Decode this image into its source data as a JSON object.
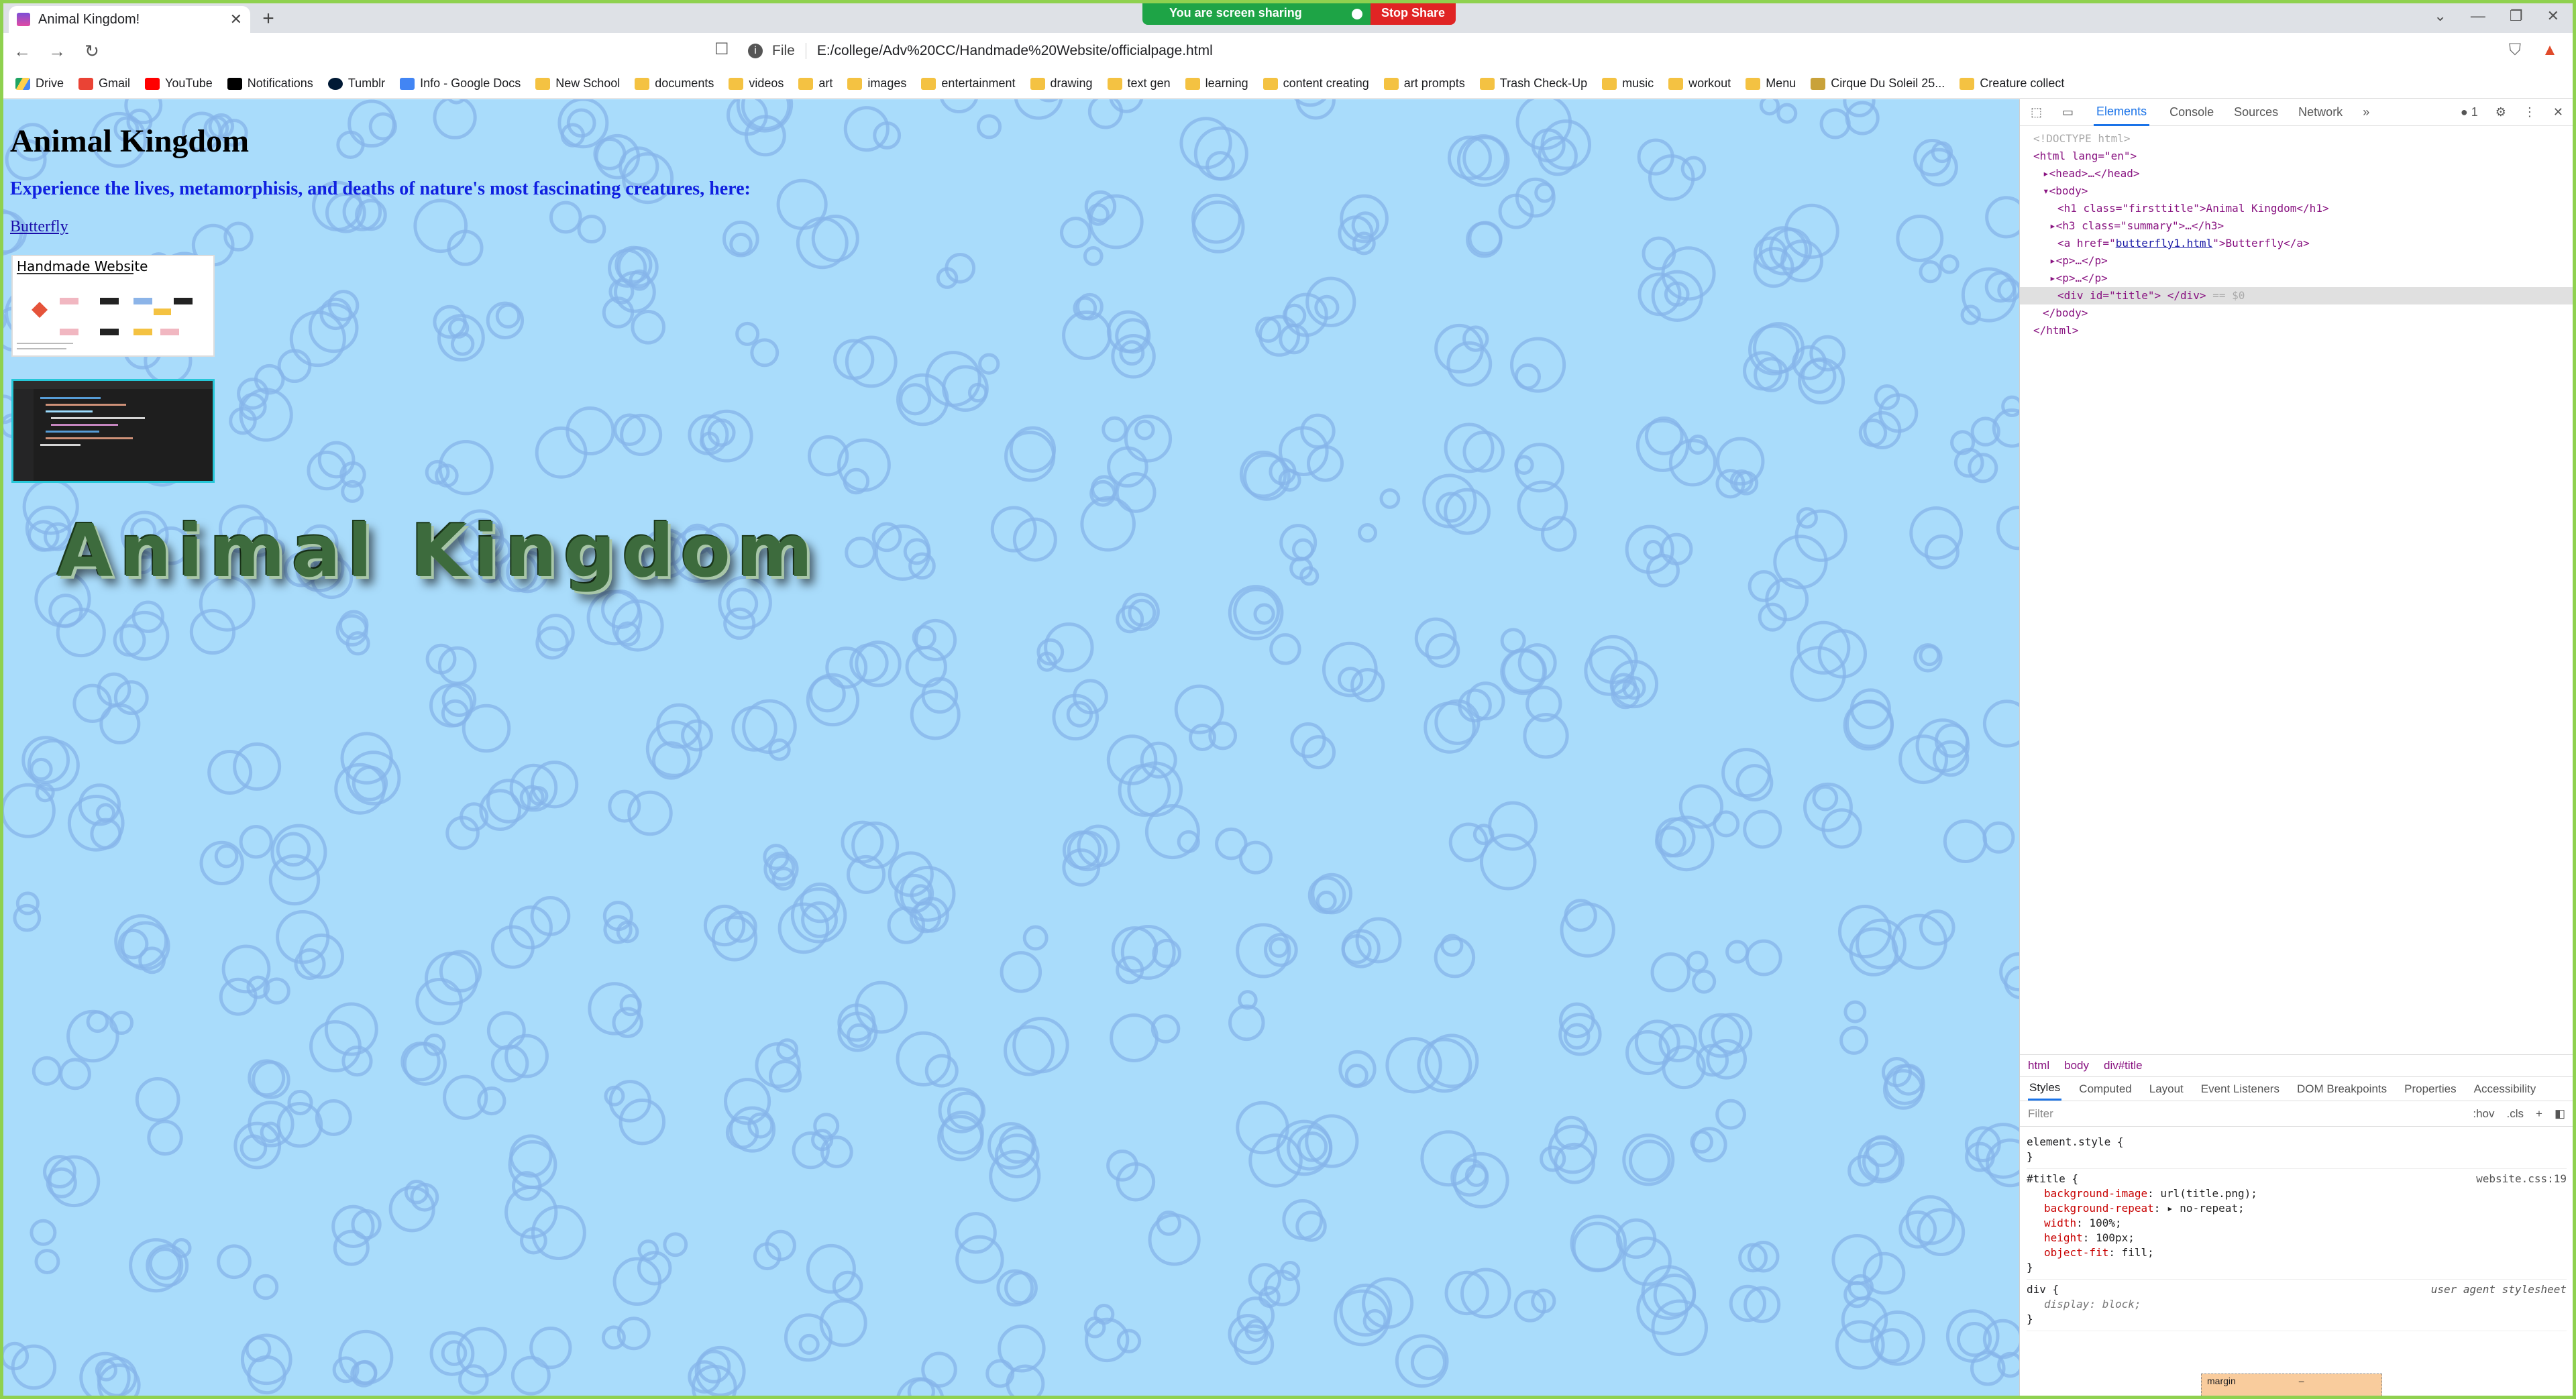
{
  "browser": {
    "tab_title": "Animal Kingdom!",
    "screen_share_label": "You are screen sharing",
    "stop_share_label": "Stop Share",
    "url_prefix": "File",
    "url": "E:/college/Adv%20CC/Handmade%20Website/officialpage.html"
  },
  "bookmarks": [
    {
      "label": "Drive",
      "icon": "drive-icon"
    },
    {
      "label": "Gmail",
      "icon": "gmail-icon"
    },
    {
      "label": "YouTube",
      "icon": "youtube-icon"
    },
    {
      "label": "Notifications",
      "icon": "x-icon"
    },
    {
      "label": "Tumblr",
      "icon": "tumblr-icon"
    },
    {
      "label": "Info - Google Docs",
      "icon": "docs-icon"
    },
    {
      "label": "New School",
      "icon": "folder-icon"
    },
    {
      "label": "documents",
      "icon": "folder-icon"
    },
    {
      "label": "videos",
      "icon": "folder-icon"
    },
    {
      "label": "art",
      "icon": "folder-icon"
    },
    {
      "label": "images",
      "icon": "folder-icon"
    },
    {
      "label": "entertainment",
      "icon": "folder-icon"
    },
    {
      "label": "drawing",
      "icon": "folder-icon"
    },
    {
      "label": "text gen",
      "icon": "folder-icon"
    },
    {
      "label": "learning",
      "icon": "folder-icon"
    },
    {
      "label": "content creating",
      "icon": "folder-icon"
    },
    {
      "label": "art prompts",
      "icon": "folder-icon"
    },
    {
      "label": "Trash Check-Up",
      "icon": "folder-icon"
    },
    {
      "label": "music",
      "icon": "folder-icon"
    },
    {
      "label": "workout",
      "icon": "folder-icon"
    },
    {
      "label": "Menu",
      "icon": "folder-icon"
    },
    {
      "label": "Cirque Du Soleil 25...",
      "icon": "cirque-icon"
    },
    {
      "label": "Creature collect",
      "icon": "folder-icon"
    }
  ],
  "page": {
    "heading": "Animal Kingdom",
    "summary": "Experience the lives, metamorphisis, and deaths of nature's most fascinating creatures, here:",
    "link_label": "Butterfly",
    "banner_text": "Animal Kingdom",
    "thumb1_title": "Handmade Website",
    "bg_color": "#a9dcfb"
  },
  "devtools": {
    "tabs": [
      "Elements",
      "Console",
      "Sources",
      "Network"
    ],
    "issues_count": "1",
    "dom_lines": {
      "doctype": "<!DOCTYPE html>",
      "html_open": "<html lang=\"en\">",
      "head": "<head>…</head>",
      "body_open": "<body>",
      "h1": "<h1 class=\"firsttitle\">Animal Kingdom</h1>",
      "h3": "<h3 class=\"summary\">…</h3>",
      "a_pre": "<a href=\"",
      "a_href": "butterfly1.html",
      "a_post": "\">Butterfly</a>",
      "p1": "<p>…</p>",
      "p2": "<p>…</p>",
      "div": "<div id=\"title\"> </div>",
      "div_marker": "== $0",
      "body_close": "</body>",
      "html_close": "</html>"
    },
    "breadcrumbs": [
      "html",
      "body",
      "div#title"
    ],
    "sub_tabs": [
      "Styles",
      "Computed",
      "Layout",
      "Event Listeners",
      "DOM Breakpoints",
      "Properties",
      "Accessibility"
    ],
    "filter_placeholder": "Filter",
    "filter_controls": [
      ":hov",
      ".cls",
      "+"
    ],
    "styles": {
      "element_style": "element.style {",
      "close": "}",
      "title_selector": "#title {",
      "title_source": "website.css:19",
      "props": [
        {
          "name": "background-image",
          "value": "url(title.png);"
        },
        {
          "name": "background-repeat",
          "value": "▸ no-repeat;"
        },
        {
          "name": "width",
          "value": "100%;"
        },
        {
          "name": "height",
          "value": "100px;"
        },
        {
          "name": "object-fit",
          "value": "fill;"
        }
      ],
      "div_selector": "div {",
      "div_source": "user agent stylesheet",
      "div_prop_name": "display",
      "div_prop_value": "block;"
    },
    "box_model_label": "margin",
    "box_model_value": "–"
  }
}
